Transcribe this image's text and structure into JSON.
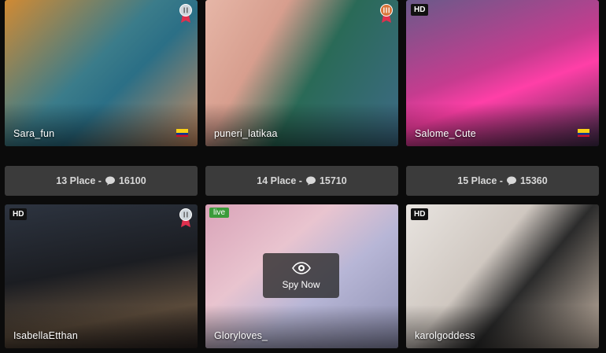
{
  "cards_top": [
    {
      "name": "Sara_fun",
      "has_flag": true,
      "badge": "medal-silver",
      "icon": "medal-icon"
    },
    {
      "name": "puneri_latikaa",
      "has_flag": false,
      "badge": "medal-bronze",
      "icon": "medal-icon"
    },
    {
      "name": "Salome_Cute",
      "has_flag": true,
      "badge": "HD"
    }
  ],
  "places": [
    {
      "label": "13 Place -",
      "count": "16100",
      "icon": "chat-bubble-icon"
    },
    {
      "label": "14 Place -",
      "count": "15710",
      "icon": "chat-bubble-icon"
    },
    {
      "label": "15 Place -",
      "count": "15360",
      "icon": "chat-bubble-icon"
    }
  ],
  "cards_bottom": [
    {
      "name": "IsabellaEtthan",
      "badge": "HD",
      "medal": "medal-silver"
    },
    {
      "name": "Gloryloves_",
      "badge": "live",
      "overlay_label": "Spy Now",
      "overlay_icon": "eye-icon"
    },
    {
      "name": "karolgoddess",
      "badge": "HD"
    }
  ],
  "colors": {
    "background": "#0b0b0b",
    "place_bar": "#3b3b3b",
    "live_badge": "#3a9b3a",
    "medal_ribbon": "#e0304e"
  }
}
